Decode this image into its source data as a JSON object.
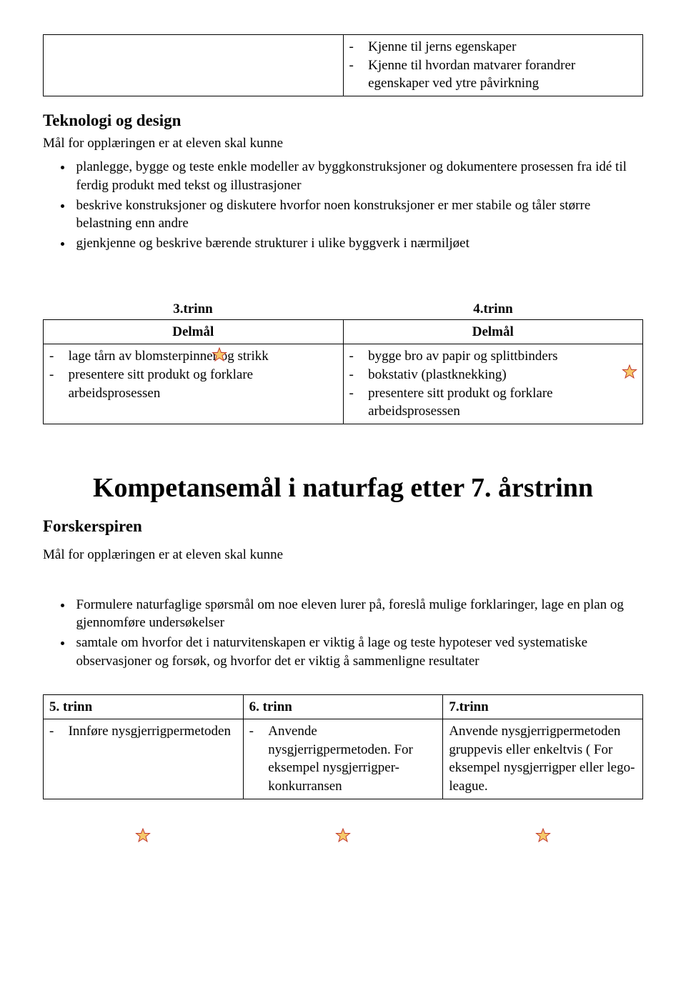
{
  "topbox": {
    "items": [
      "Kjenne til jerns egenskaper",
      "Kjenne til hvordan matvarer forandrer egenskaper ved ytre påvirkning"
    ]
  },
  "section1": {
    "heading": "Teknologi og design",
    "intro": "Mål for opplæringen er at eleven skal kunne",
    "bullets": [
      "planlegge, bygge og teste enkle modeller av byggkonstruksjoner og dokumentere prosessen fra idé til ferdig produkt med tekst og illustrasjoner",
      "beskrive konstruksjoner og diskutere hvorfor noen konstruksjoner er mer stabile og tåler større belastning enn andre",
      "gjenkjenne og beskrive bærende strukturer i ulike byggverk i nærmiljøet"
    ]
  },
  "table1": {
    "h1": "3.trinn",
    "h2": "4.trinn",
    "sub1": "Delmål",
    "sub2": "Delmål",
    "left": [
      "lage tårn av blomsterpinner og strikk",
      "presentere sitt produkt og forklare arbeidsprosessen"
    ],
    "right": [
      "bygge bro av papir og splittbinders",
      "bokstativ (plastknekking)",
      "presentere sitt produkt og forklare arbeidsprosessen"
    ]
  },
  "bigtitle": "Kompetansemål i naturfag etter 7. årstrinn",
  "section2": {
    "heading": "Forskerspiren",
    "intro": "Mål for opplæringen er at eleven skal kunne",
    "bullets": [
      "Formulere naturfaglige spørsmål om noe eleven lurer på, foreslå mulige forklaringer, lage en plan og gjennomføre undersøkelser",
      "samtale om hvorfor det i naturvitenskapen er viktig å lage og teste hypoteser ved systematiske observasjoner og forsøk, og hvorfor det er viktig å sammenligne resultater"
    ]
  },
  "table2": {
    "h1": "5. trinn",
    "h2": "6. trinn",
    "h3": "7.trinn",
    "c1": [
      "Innføre nysgjerrigpermetoden"
    ],
    "c2": [
      "Anvende nysgjerrigpermetoden. For eksempel nysgjerrigper-konkurransen"
    ],
    "c3": "Anvende nysgjerrigpermetoden gruppevis eller enkeltvis ( For eksempel nysgjerrigper eller lego- league."
  }
}
